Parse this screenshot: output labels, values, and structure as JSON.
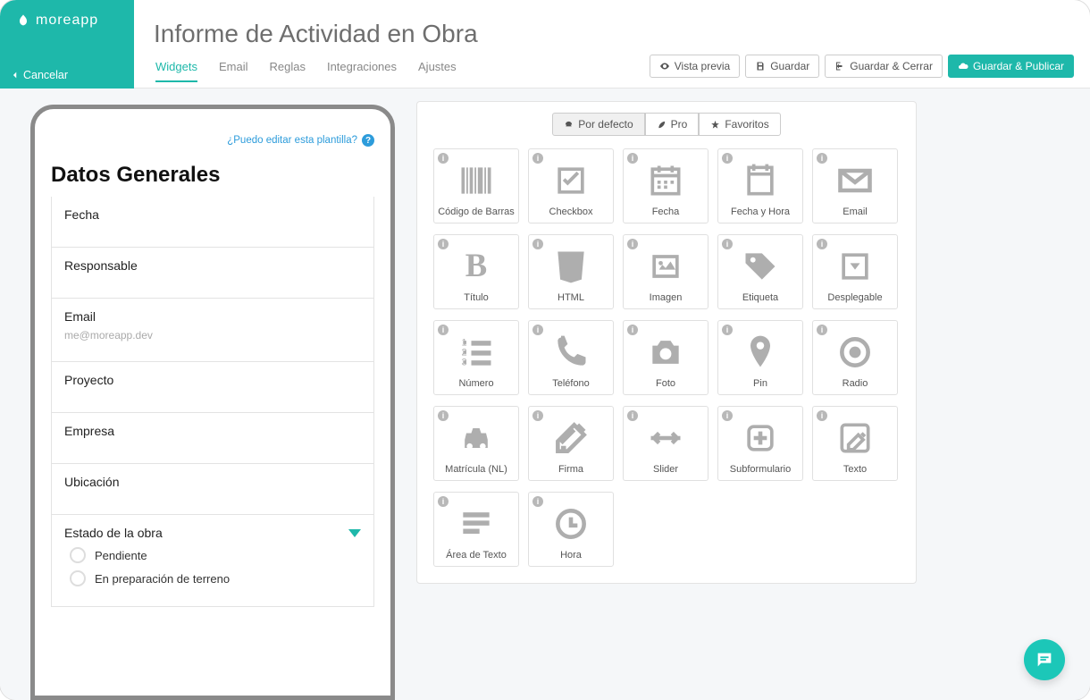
{
  "brand": "moreapp",
  "cancel": "Cancelar",
  "title": "Informe de Actividad en Obra",
  "tabs": {
    "widgets": "Widgets",
    "email": "Email",
    "rules": "Reglas",
    "integrations": "Integraciones",
    "settings": "Ajustes"
  },
  "actions": {
    "preview": "Vista previa",
    "save": "Guardar",
    "saveClose": "Guardar & Cerrar",
    "savePublish": "Guardar & Publicar"
  },
  "help_link": "¿Puedo editar esta plantilla?",
  "form": {
    "section": "Datos Generales",
    "fields": {
      "fecha": "Fecha",
      "responsable": "Responsable",
      "email": "Email",
      "email_placeholder": "me@moreapp.dev",
      "proyecto": "Proyecto",
      "empresa": "Empresa",
      "ubicacion": "Ubicación",
      "estado": "Estado de la obra",
      "opt1": "Pendiente",
      "opt2": "En preparación de terreno"
    }
  },
  "widget_tabs": {
    "default": "Por defecto",
    "pro": "Pro",
    "favorites": "Favoritos"
  },
  "widgets": {
    "barcode": "Código de Barras",
    "checkbox": "Checkbox",
    "date": "Fecha",
    "datetime": "Fecha y Hora",
    "email": "Email",
    "title": "Título",
    "html": "HTML",
    "image": "Imagen",
    "label": "Etiqueta",
    "dropdown": "Desplegable",
    "number": "Número",
    "phone": "Teléfono",
    "photo": "Foto",
    "pin": "Pin",
    "radio": "Radio",
    "plate": "Matrícula (NL)",
    "signature": "Firma",
    "slider": "Slider",
    "subform": "Subformulario",
    "text": "Texto",
    "textarea": "Área de Texto",
    "time": "Hora"
  }
}
